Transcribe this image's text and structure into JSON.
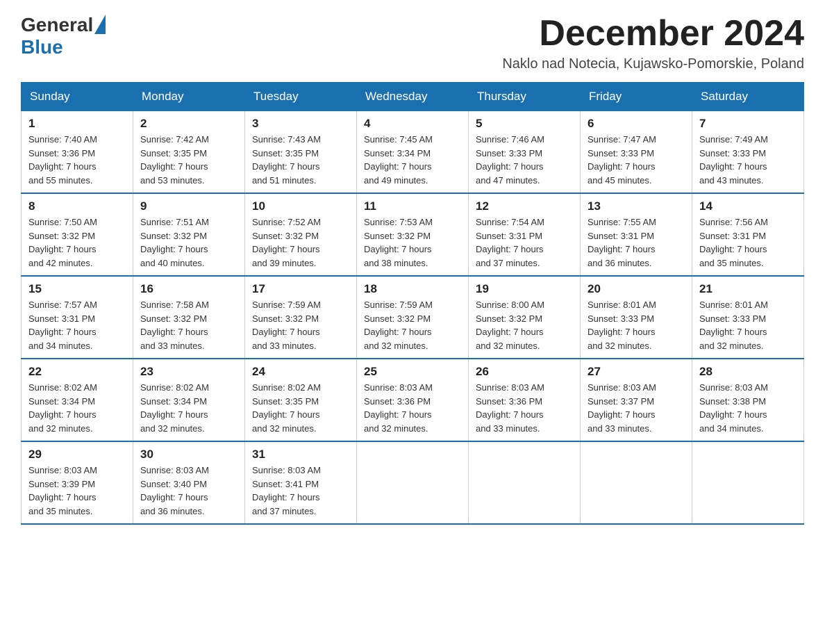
{
  "header": {
    "logo_general": "General",
    "logo_blue": "Blue",
    "month_title": "December 2024",
    "location": "Naklo nad Notecia, Kujawsko-Pomorskie, Poland"
  },
  "weekdays": [
    "Sunday",
    "Monday",
    "Tuesday",
    "Wednesday",
    "Thursday",
    "Friday",
    "Saturday"
  ],
  "weeks": [
    [
      {
        "day": "1",
        "sunrise": "7:40 AM",
        "sunset": "3:36 PM",
        "daylight": "7 hours and 55 minutes."
      },
      {
        "day": "2",
        "sunrise": "7:42 AM",
        "sunset": "3:35 PM",
        "daylight": "7 hours and 53 minutes."
      },
      {
        "day": "3",
        "sunrise": "7:43 AM",
        "sunset": "3:35 PM",
        "daylight": "7 hours and 51 minutes."
      },
      {
        "day": "4",
        "sunrise": "7:45 AM",
        "sunset": "3:34 PM",
        "daylight": "7 hours and 49 minutes."
      },
      {
        "day": "5",
        "sunrise": "7:46 AM",
        "sunset": "3:33 PM",
        "daylight": "7 hours and 47 minutes."
      },
      {
        "day": "6",
        "sunrise": "7:47 AM",
        "sunset": "3:33 PM",
        "daylight": "7 hours and 45 minutes."
      },
      {
        "day": "7",
        "sunrise": "7:49 AM",
        "sunset": "3:33 PM",
        "daylight": "7 hours and 43 minutes."
      }
    ],
    [
      {
        "day": "8",
        "sunrise": "7:50 AM",
        "sunset": "3:32 PM",
        "daylight": "7 hours and 42 minutes."
      },
      {
        "day": "9",
        "sunrise": "7:51 AM",
        "sunset": "3:32 PM",
        "daylight": "7 hours and 40 minutes."
      },
      {
        "day": "10",
        "sunrise": "7:52 AM",
        "sunset": "3:32 PM",
        "daylight": "7 hours and 39 minutes."
      },
      {
        "day": "11",
        "sunrise": "7:53 AM",
        "sunset": "3:32 PM",
        "daylight": "7 hours and 38 minutes."
      },
      {
        "day": "12",
        "sunrise": "7:54 AM",
        "sunset": "3:31 PM",
        "daylight": "7 hours and 37 minutes."
      },
      {
        "day": "13",
        "sunrise": "7:55 AM",
        "sunset": "3:31 PM",
        "daylight": "7 hours and 36 minutes."
      },
      {
        "day": "14",
        "sunrise": "7:56 AM",
        "sunset": "3:31 PM",
        "daylight": "7 hours and 35 minutes."
      }
    ],
    [
      {
        "day": "15",
        "sunrise": "7:57 AM",
        "sunset": "3:31 PM",
        "daylight": "7 hours and 34 minutes."
      },
      {
        "day": "16",
        "sunrise": "7:58 AM",
        "sunset": "3:32 PM",
        "daylight": "7 hours and 33 minutes."
      },
      {
        "day": "17",
        "sunrise": "7:59 AM",
        "sunset": "3:32 PM",
        "daylight": "7 hours and 33 minutes."
      },
      {
        "day": "18",
        "sunrise": "7:59 AM",
        "sunset": "3:32 PM",
        "daylight": "7 hours and 32 minutes."
      },
      {
        "day": "19",
        "sunrise": "8:00 AM",
        "sunset": "3:32 PM",
        "daylight": "7 hours and 32 minutes."
      },
      {
        "day": "20",
        "sunrise": "8:01 AM",
        "sunset": "3:33 PM",
        "daylight": "7 hours and 32 minutes."
      },
      {
        "day": "21",
        "sunrise": "8:01 AM",
        "sunset": "3:33 PM",
        "daylight": "7 hours and 32 minutes."
      }
    ],
    [
      {
        "day": "22",
        "sunrise": "8:02 AM",
        "sunset": "3:34 PM",
        "daylight": "7 hours and 32 minutes."
      },
      {
        "day": "23",
        "sunrise": "8:02 AM",
        "sunset": "3:34 PM",
        "daylight": "7 hours and 32 minutes."
      },
      {
        "day": "24",
        "sunrise": "8:02 AM",
        "sunset": "3:35 PM",
        "daylight": "7 hours and 32 minutes."
      },
      {
        "day": "25",
        "sunrise": "8:03 AM",
        "sunset": "3:36 PM",
        "daylight": "7 hours and 32 minutes."
      },
      {
        "day": "26",
        "sunrise": "8:03 AM",
        "sunset": "3:36 PM",
        "daylight": "7 hours and 33 minutes."
      },
      {
        "day": "27",
        "sunrise": "8:03 AM",
        "sunset": "3:37 PM",
        "daylight": "7 hours and 33 minutes."
      },
      {
        "day": "28",
        "sunrise": "8:03 AM",
        "sunset": "3:38 PM",
        "daylight": "7 hours and 34 minutes."
      }
    ],
    [
      {
        "day": "29",
        "sunrise": "8:03 AM",
        "sunset": "3:39 PM",
        "daylight": "7 hours and 35 minutes."
      },
      {
        "day": "30",
        "sunrise": "8:03 AM",
        "sunset": "3:40 PM",
        "daylight": "7 hours and 36 minutes."
      },
      {
        "day": "31",
        "sunrise": "8:03 AM",
        "sunset": "3:41 PM",
        "daylight": "7 hours and 37 minutes."
      },
      null,
      null,
      null,
      null
    ]
  ],
  "labels": {
    "sunrise": "Sunrise:",
    "sunset": "Sunset:",
    "daylight": "Daylight:"
  }
}
